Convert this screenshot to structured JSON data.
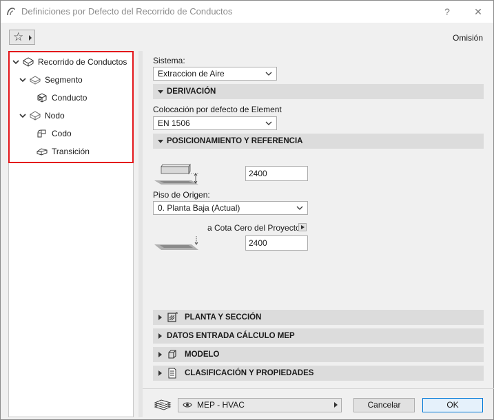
{
  "window": {
    "title": "Definiciones por Defecto del Recorrido de Conductos",
    "help_label": "?",
    "close_label": "✕"
  },
  "header": {
    "omision_label": "Omisión"
  },
  "tree": {
    "items": [
      {
        "label": "Recorrido de Conductos"
      },
      {
        "label": "Segmento"
      },
      {
        "label": "Conducto"
      },
      {
        "label": "Nodo"
      },
      {
        "label": "Codo"
      },
      {
        "label": "Transición"
      }
    ]
  },
  "settings": {
    "sistema_label": "Sistema:",
    "sistema_value": "Extraccion de Aire",
    "derivacion_header": "DERIVACIÓN",
    "colocacion_label": "Colocación por defecto de Element",
    "colocacion_value": "EN 1506",
    "posicionamiento_header": "POSICIONAMIENTO Y REFERENCIA",
    "height_value_1": "2400",
    "piso_label": "Piso de Origen:",
    "piso_value": "0. Planta Baja (Actual)",
    "cota_label": "a Cota Cero del Proyecto",
    "height_value_2": "2400",
    "planta_header": "PLANTA Y SECCIÓN",
    "datos_header": "DATOS ENTRADA CÁLCULO MEP",
    "modelo_header": "MODELO",
    "clasificacion_header": "CLASIFICACIÓN Y PROPIEDADES"
  },
  "footer": {
    "view_value": "MEP - HVAC",
    "cancel_label": "Cancelar",
    "ok_label": "OK"
  },
  "colors": {
    "highlight": "#e3151a",
    "section_bg": "#dcdcdc",
    "primary_border": "#0078d7"
  }
}
